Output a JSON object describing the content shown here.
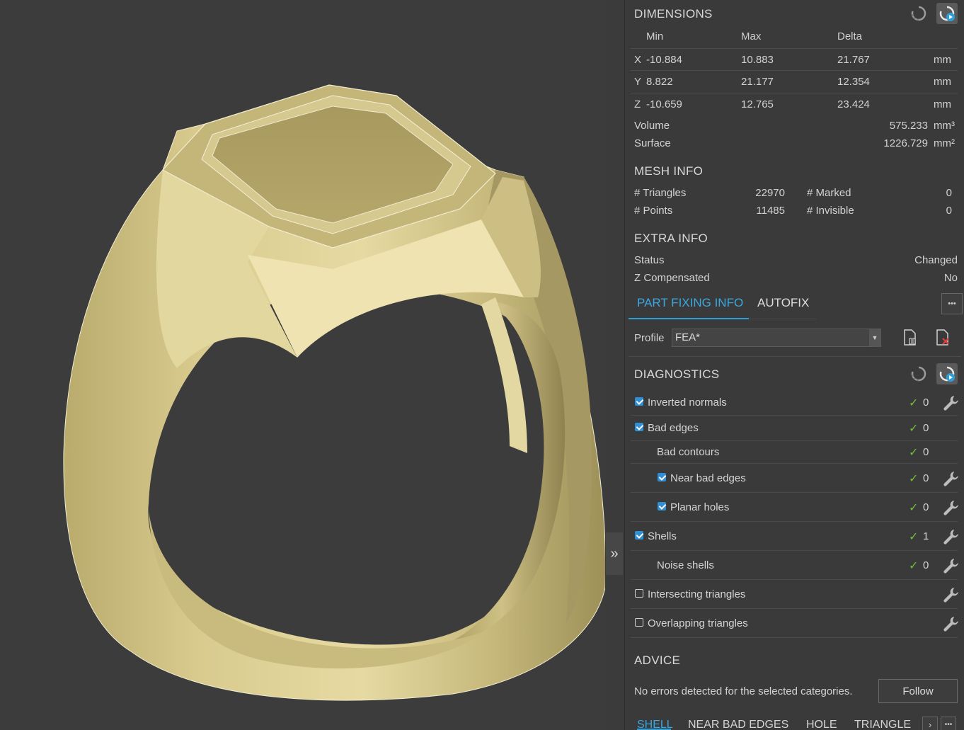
{
  "dimensions": {
    "title": "DIMENSIONS",
    "headers": [
      "Min",
      "Max",
      "Delta"
    ],
    "rows": [
      {
        "axis": "X",
        "min": "-10.884",
        "max": "10.883",
        "delta": "21.767",
        "unit": "mm"
      },
      {
        "axis": "Y",
        "min": "8.822",
        "max": "21.177",
        "delta": "12.354",
        "unit": "mm"
      },
      {
        "axis": "Z",
        "min": "-10.659",
        "max": "12.765",
        "delta": "23.424",
        "unit": "mm"
      }
    ],
    "volume_label": "Volume",
    "volume_value": "575.233",
    "volume_unit": "mm³",
    "surface_label": "Surface",
    "surface_value": "1226.729",
    "surface_unit": "mm²"
  },
  "mesh_info": {
    "title": "MESH INFO",
    "triangles_label": "# Triangles",
    "triangles_value": "22970",
    "marked_label": "# Marked",
    "marked_value": "0",
    "points_label": "# Points",
    "points_value": "11485",
    "invisible_label": "# Invisible",
    "invisible_value": "0"
  },
  "extra_info": {
    "title": "EXTRA INFO",
    "status_label": "Status",
    "status_value": "Changed",
    "zcomp_label": "Z Compensated",
    "zcomp_value": "No"
  },
  "tabs": {
    "part_fixing": "PART FIXING INFO",
    "autofix": "AUTOFIX",
    "more": "•••"
  },
  "profile": {
    "label": "Profile",
    "value": "FEA*"
  },
  "diagnostics": {
    "title": "DIAGNOSTICS",
    "items": [
      {
        "label": "Inverted normals",
        "checked": "true",
        "check": "✓",
        "count": "0"
      },
      {
        "label": "Bad edges",
        "checked": "true",
        "check": "✓",
        "count": "0"
      },
      {
        "label": "Bad contours",
        "checked": "none",
        "check": "✓",
        "count": "0"
      },
      {
        "label": "Near bad edges",
        "checked": "true",
        "check": "✓",
        "count": "0"
      },
      {
        "label": "Planar holes",
        "checked": "true",
        "check": "✓",
        "count": "0"
      },
      {
        "label": "Shells",
        "checked": "true",
        "check": "✓",
        "count": "1"
      },
      {
        "label": "Noise shells",
        "checked": "none",
        "check": "✓",
        "count": "0"
      },
      {
        "label": "Intersecting triangles",
        "checked": "false",
        "check": "",
        "count": ""
      },
      {
        "label": "Overlapping triangles",
        "checked": "false",
        "check": "",
        "count": ""
      }
    ]
  },
  "advice": {
    "title": "ADVICE",
    "text": "No errors detected for the selected categories.",
    "follow_label": "Follow"
  },
  "bottom_tabs": [
    "SHELL",
    "NEAR BAD EDGES",
    "HOLE",
    "TRIANGLE"
  ],
  "bottom_nav": {
    "next": "›",
    "more": "•••"
  },
  "collapse_glyph": "»",
  "colors": {
    "accent": "#2e9fd6",
    "ok_check": "#6fbf3d",
    "ring_gold": "#d6c98f"
  },
  "icons": {
    "refresh": "refresh-icon",
    "auto_refresh": "auto-refresh-icon",
    "wrench": "wrench-icon",
    "profile_edit": "profile-document-icon",
    "profile_delete": "profile-delete-icon"
  }
}
